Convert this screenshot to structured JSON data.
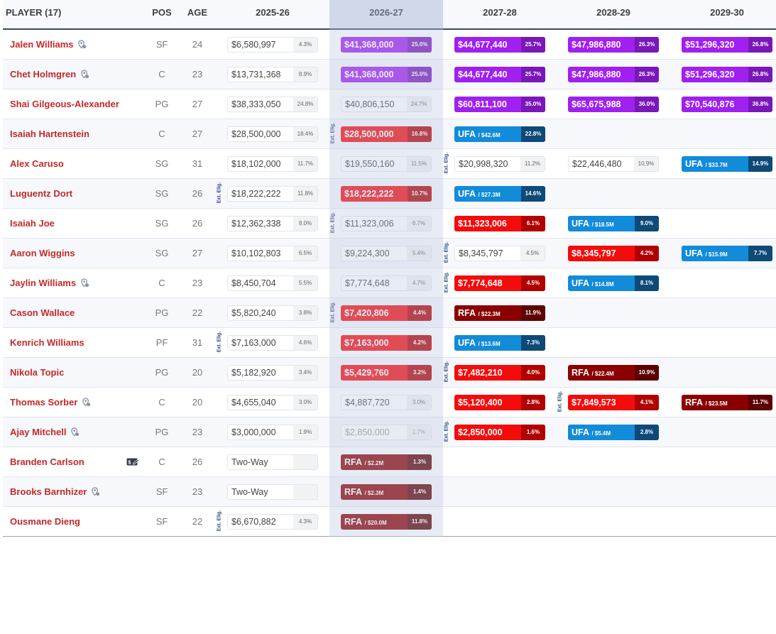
{
  "header": {
    "player": "PLAYER (17)",
    "pos": "POS",
    "age": "AGE",
    "seasons": [
      "2025-26",
      "2026-27",
      "2027-28",
      "2028-29",
      "2029-30"
    ]
  },
  "ext_label": "Ext. Elig.",
  "colors": {
    "purple": "#a020f0",
    "red": "#f40b0b",
    "ufa_blue": "#128bd9",
    "rfa_dark_red": "#8a0000",
    "player_link": "#c62828"
  },
  "rows": [
    {
      "name": "Jalen Williams",
      "pin": true,
      "pos": "SF",
      "age": "24",
      "ext": [],
      "c": [
        {
          "t": "g",
          "a": "$6,580,997",
          "p": "4.3%"
        },
        {
          "t": "p",
          "a": "$41,368,000",
          "p": "25.0%"
        },
        {
          "t": "p",
          "a": "$44,677,440",
          "p": "25.7%"
        },
        {
          "t": "p",
          "a": "$47,986,880",
          "p": "26.3%"
        },
        {
          "t": "p",
          "a": "$51,296,320",
          "p": "26.8%"
        }
      ]
    },
    {
      "name": "Chet Holmgren",
      "pin": true,
      "pos": "C",
      "age": "23",
      "ext": [],
      "c": [
        {
          "t": "g",
          "a": "$13,731,368",
          "p": "8.9%"
        },
        {
          "t": "p",
          "a": "$41,368,000",
          "p": "25.0%"
        },
        {
          "t": "p",
          "a": "$44,677,440",
          "p": "25.7%"
        },
        {
          "t": "p",
          "a": "$47,986,880",
          "p": "26.3%"
        },
        {
          "t": "p",
          "a": "$51,296,320",
          "p": "26.8%"
        }
      ]
    },
    {
      "name": "Shai Gilgeous-Alexander",
      "pin": false,
      "pos": "PG",
      "age": "27",
      "ext": [],
      "c": [
        {
          "t": "g",
          "a": "$38,333,050",
          "p": "24.8%"
        },
        {
          "t": "g",
          "a": "$40,806,150",
          "p": "24.7%"
        },
        {
          "t": "p",
          "a": "$60,811,100",
          "p": "35.0%"
        },
        {
          "t": "p",
          "a": "$65,675,988",
          "p": "36.0%"
        },
        {
          "t": "p",
          "a": "$70,540,876",
          "p": "36.8%"
        }
      ]
    },
    {
      "name": "Isaiah Hartenstein",
      "pin": false,
      "pos": "C",
      "age": "27",
      "ext": [
        1
      ],
      "c": [
        {
          "t": "g",
          "a": "$28,500,000",
          "p": "18.4%"
        },
        {
          "t": "r",
          "a": "$28,500,000",
          "p": "16.8%"
        },
        {
          "t": "u",
          "f": "UFA",
          "cap": "/ $42.6M",
          "p": "22.8%"
        },
        null,
        null
      ]
    },
    {
      "name": "Alex Caruso",
      "pin": false,
      "pos": "SG",
      "age": "31",
      "ext": [
        2
      ],
      "c": [
        {
          "t": "g",
          "a": "$18,102,000",
          "p": "11.7%"
        },
        {
          "t": "g",
          "a": "$19,550,160",
          "p": "11.5%"
        },
        {
          "t": "g",
          "a": "$20,998,320",
          "p": "11.2%"
        },
        {
          "t": "g",
          "a": "$22,446,480",
          "p": "10.9%"
        },
        {
          "t": "u",
          "f": "UFA",
          "cap": "/ $33.7M",
          "p": "14.9%"
        }
      ]
    },
    {
      "name": "Luguentz Dort",
      "pin": false,
      "pos": "SG",
      "age": "26",
      "ext": [
        0
      ],
      "c": [
        {
          "t": "g",
          "a": "$18,222,222",
          "p": "11.8%"
        },
        {
          "t": "r",
          "a": "$18,222,222",
          "p": "10.7%"
        },
        {
          "t": "u",
          "f": "UFA",
          "cap": "/ $27.3M",
          "p": "14.6%"
        },
        null,
        null
      ]
    },
    {
      "name": "Isaiah Joe",
      "pin": false,
      "pos": "SG",
      "age": "26",
      "ext": [
        1
      ],
      "c": [
        {
          "t": "g",
          "a": "$12,362,338",
          "p": "8.0%"
        },
        {
          "t": "g",
          "a": "$11,323,006",
          "p": "6.7%"
        },
        {
          "t": "r",
          "a": "$11,323,006",
          "p": "6.1%"
        },
        {
          "t": "u",
          "f": "UFA",
          "cap": "/ $18.5M",
          "p": "9.0%"
        },
        null
      ]
    },
    {
      "name": "Aaron Wiggins",
      "pin": false,
      "pos": "SG",
      "age": "27",
      "ext": [
        2
      ],
      "c": [
        {
          "t": "g",
          "a": "$10,102,803",
          "p": "6.5%"
        },
        {
          "t": "g",
          "a": "$9,224,300",
          "p": "5.4%"
        },
        {
          "t": "g",
          "a": "$8,345,797",
          "p": "4.5%"
        },
        {
          "t": "r",
          "a": "$8,345,797",
          "p": "4.2%"
        },
        {
          "t": "u",
          "f": "UFA",
          "cap": "/ $15.9M",
          "p": "7.7%"
        }
      ]
    },
    {
      "name": "Jaylin Williams",
      "pin": true,
      "pos": "C",
      "age": "23",
      "ext": [
        2
      ],
      "c": [
        {
          "t": "g",
          "a": "$8,450,704",
          "p": "5.5%"
        },
        {
          "t": "g",
          "a": "$7,774,648",
          "p": "4.7%"
        },
        {
          "t": "r",
          "a": "$7,774,648",
          "p": "4.5%"
        },
        {
          "t": "u",
          "f": "UFA",
          "cap": "/ $14.8M",
          "p": "8.1%"
        },
        null
      ]
    },
    {
      "name": "Cason Wallace",
      "pin": false,
      "pos": "PG",
      "age": "22",
      "ext": [
        1
      ],
      "c": [
        {
          "t": "g",
          "a": "$5,820,240",
          "p": "3.8%"
        },
        {
          "t": "r",
          "a": "$7,420,806",
          "p": "4.4%"
        },
        {
          "t": "f",
          "f": "RFA",
          "cap": "/ $22.3M",
          "p": "11.9%"
        },
        null,
        null
      ]
    },
    {
      "name": "Kenrich Williams",
      "pin": false,
      "pos": "PF",
      "age": "31",
      "ext": [
        0
      ],
      "c": [
        {
          "t": "g",
          "a": "$7,163,000",
          "p": "4.6%"
        },
        {
          "t": "r",
          "a": "$7,163,000",
          "p": "4.2%"
        },
        {
          "t": "u",
          "f": "UFA",
          "cap": "/ $13.6M",
          "p": "7.3%"
        },
        null,
        null
      ]
    },
    {
      "name": "Nikola Topic",
      "pin": false,
      "pos": "PG",
      "age": "20",
      "ext": [
        2
      ],
      "c": [
        {
          "t": "g",
          "a": "$5,182,920",
          "p": "3.4%"
        },
        {
          "t": "r",
          "a": "$5,429,760",
          "p": "3.2%"
        },
        {
          "t": "r",
          "a": "$7,482,210",
          "p": "4.0%"
        },
        {
          "t": "f",
          "f": "RFA",
          "cap": "/ $22.4M",
          "p": "10.9%"
        },
        null
      ]
    },
    {
      "name": "Thomas Sorber",
      "pin": true,
      "pos": "C",
      "age": "20",
      "ext": [
        3
      ],
      "c": [
        {
          "t": "g",
          "a": "$4,655,040",
          "p": "3.0%"
        },
        {
          "t": "g",
          "a": "$4,887,720",
          "p": "3.0%"
        },
        {
          "t": "r",
          "a": "$5,120,400",
          "p": "2.8%"
        },
        {
          "t": "r",
          "a": "$7,849,573",
          "p": "4.1%"
        },
        {
          "t": "f",
          "f": "RFA",
          "cap": "/ $23.5M",
          "p": "11.7%"
        }
      ]
    },
    {
      "name": "Ajay Mitchell",
      "pin": true,
      "pos": "PG",
      "age": "23",
      "ext": [
        2
      ],
      "c": [
        {
          "t": "g",
          "a": "$3,000,000",
          "p": "1.9%"
        },
        {
          "t": "gl",
          "a": "$2,850,000",
          "p": "1.7%"
        },
        {
          "t": "r",
          "a": "$2,850,000",
          "p": "1.6%"
        },
        {
          "t": "u",
          "f": "UFA",
          "cap": "/ $5.4M",
          "p": "2.8%"
        },
        null
      ]
    },
    {
      "name": "Branden Carlson",
      "pin": false,
      "twoway": true,
      "pos": "C",
      "age": "26",
      "ext": [],
      "c": [
        {
          "t": "tw",
          "a": "Two-Way",
          "p": ""
        },
        {
          "t": "f",
          "f": "RFA",
          "cap": "/ $2.2M",
          "p": "1.3%"
        },
        null,
        null,
        null
      ]
    },
    {
      "name": "Brooks Barnhizer",
      "pin": true,
      "pos": "SF",
      "age": "23",
      "ext": [],
      "c": [
        {
          "t": "tw",
          "a": "Two-Way",
          "p": ""
        },
        {
          "t": "f",
          "f": "RFA",
          "cap": "/ $2.3M",
          "p": "1.4%"
        },
        null,
        null,
        null
      ]
    },
    {
      "name": "Ousmane Dieng",
      "pin": false,
      "pos": "SF",
      "age": "22",
      "ext": [
        0
      ],
      "c": [
        {
          "t": "g",
          "a": "$6,670,882",
          "p": "4.3%"
        },
        {
          "t": "f",
          "f": "RFA",
          "cap": "/ $20.0M",
          "p": "11.8%"
        },
        null,
        null,
        null
      ]
    }
  ]
}
